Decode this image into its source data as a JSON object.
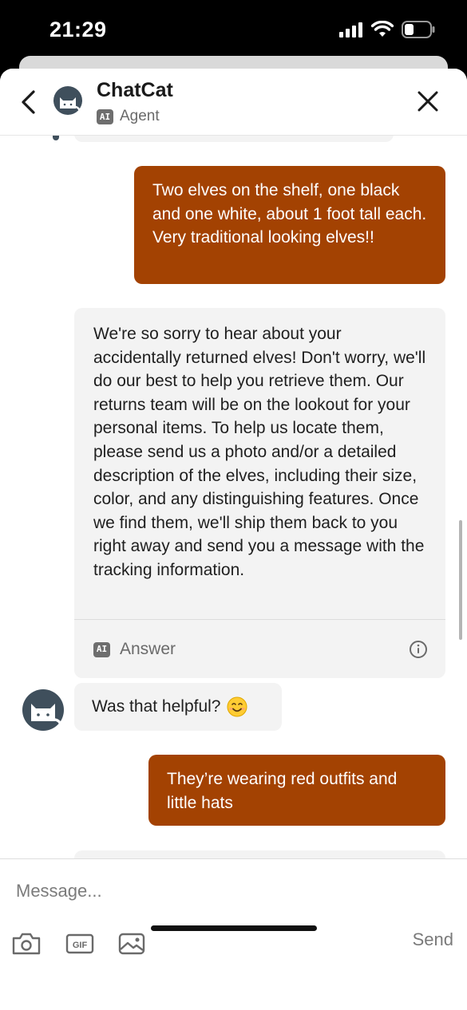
{
  "status_bar": {
    "time": "21:29",
    "icons": [
      "signal-icon",
      "wifi-icon",
      "battery-icon"
    ]
  },
  "header": {
    "title": "ChatCat",
    "badge": "AI",
    "subtitle": "Agent",
    "icons": [
      "back-chevron-icon",
      "cat-avatar-icon",
      "close-icon"
    ]
  },
  "messages": [
    {
      "role": "user",
      "text": "Two elves on the shelf, one black and one white, about 1 foot tall each. Very traditional looking elves!!"
    },
    {
      "role": "agent",
      "text": "We're so sorry to hear about your accidentally returned elves! Don't worry, we'll do our best to help you retrieve them. Our returns team will be on the lookout for your personal items. To help us locate them, please send us a photo and/or a detailed description of the elves, including their size, color, and any distinguishing features. Once we find them, we'll ship them back to you right away and send you a message with the tracking information.",
      "footer_badge": "AI",
      "footer_label": "Answer"
    },
    {
      "role": "agent",
      "text": "Was that helpful?"
    },
    {
      "role": "user",
      "text": "They’re wearing red outfits and little hats"
    }
  ],
  "composer": {
    "placeholder": "Message...",
    "gif_label": "GIF",
    "send_label": "Send",
    "icons": [
      "camera-icon",
      "gif-icon",
      "image-icon"
    ]
  },
  "colors": {
    "user_bubble": "#a34202",
    "agent_bubble": "#f3f3f3",
    "avatar": "#3f4f5c"
  }
}
